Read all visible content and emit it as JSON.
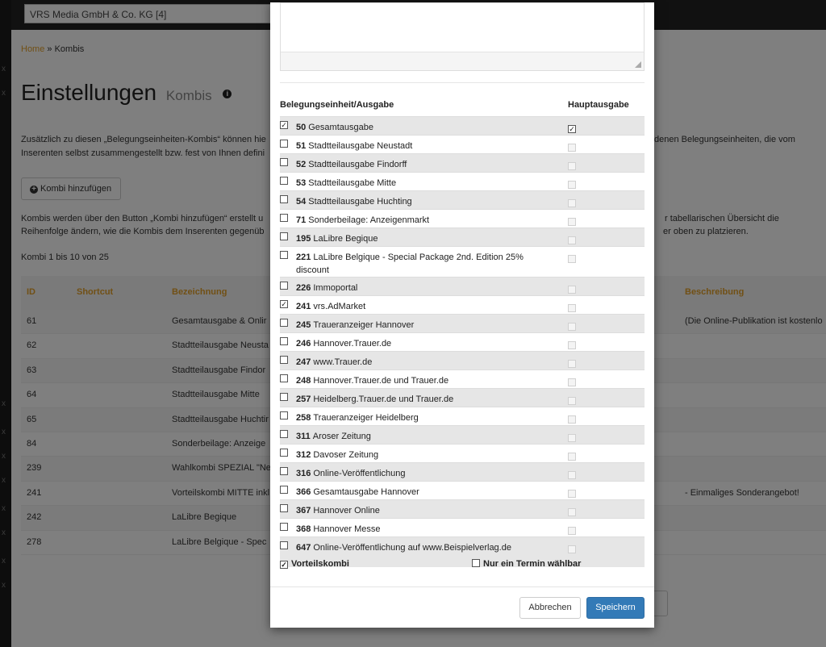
{
  "app": {
    "selected_account": "VRS Media GmbH & Co. KG [4]"
  },
  "breadcrumb": {
    "home": "Home",
    "separator": "»",
    "current": "Kombis"
  },
  "page": {
    "title": "Einstellungen",
    "subtitle": "Kombis",
    "intro_line1": "Zusätzlich zu diesen „Belegungseinheiten-Kombis“ können hie",
    "intro_line1_right": "denen Belegungseinheiten, die vom",
    "intro_line2": "Inserenten selbst zusammengestellt bzw. fest von Ihnen defini",
    "add_button": "Kombi hinzufügen",
    "desc_line1": "Kombis werden über den Button „Kombi hinzufügen“ erstellt u",
    "desc_line1_right": "r tabellarischen Übersicht die",
    "desc_line2": "Reihenfolge ändern, wie die Kombis dem Inserenten gegenüb",
    "desc_line2_right": "er oben zu platzieren.",
    "count": "Kombi 1 bis 10 von 25"
  },
  "table": {
    "headers": {
      "id": "ID",
      "shortcut": "Shortcut",
      "name": "Bezeichnung",
      "description": "Beschreibung"
    },
    "rows": [
      {
        "id": "61",
        "name": "Gesamtausgabe & Onlir",
        "description": "(Die Online-Publikation ist kostenlo"
      },
      {
        "id": "62",
        "name": "Stadtteilausgabe Neusta",
        "description": ""
      },
      {
        "id": "63",
        "name": "Stadtteilausgabe Findor",
        "description": ""
      },
      {
        "id": "64",
        "name": "Stadtteilausgabe Mitte",
        "description": ""
      },
      {
        "id": "65",
        "name": "Stadtteilausgabe Huchtir",
        "description": ""
      },
      {
        "id": "84",
        "name": "Sonderbeilage: Anzeige",
        "description": ""
      },
      {
        "id": "239",
        "name": "Wahlkombi SPEZIAL \"Ne",
        "description": ""
      },
      {
        "id": "241",
        "name": "Vorteilskombi MITTE inkl",
        "description": "- Einmaliges Sonderangebot!"
      },
      {
        "id": "242",
        "name": "LaLibre Begique",
        "description": ""
      },
      {
        "id": "278",
        "name": "LaLibre Belgique - Spec",
        "description": ""
      }
    ]
  },
  "modal": {
    "col_unit": "Belegungseinheit/Ausgabe",
    "col_main": "Hauptausgabe",
    "units": [
      {
        "num": "50",
        "label": "Gesamtausgabe",
        "checked": true,
        "main": true
      },
      {
        "num": "51",
        "label": "Stadtteilausgabe Neustadt",
        "checked": false,
        "main": false
      },
      {
        "num": "52",
        "label": "Stadtteilausgabe Findorff",
        "checked": false,
        "main": false
      },
      {
        "num": "53",
        "label": "Stadtteilausgabe Mitte",
        "checked": false,
        "main": false
      },
      {
        "num": "54",
        "label": "Stadtteilausgabe Huchting",
        "checked": false,
        "main": false
      },
      {
        "num": "71",
        "label": "Sonderbeilage: Anzeigenmarkt",
        "checked": false,
        "main": false
      },
      {
        "num": "195",
        "label": "LaLibre Begique",
        "checked": false,
        "main": false
      },
      {
        "num": "221",
        "label": "LaLibre Belgique - Special Package 2nd. Edition 25% discount",
        "checked": false,
        "main": false
      },
      {
        "num": "226",
        "label": "Immoportal",
        "checked": false,
        "main": false
      },
      {
        "num": "241",
        "label": "vrs.AdMarket",
        "checked": true,
        "main": false
      },
      {
        "num": "245",
        "label": "Traueranzeiger Hannover",
        "checked": false,
        "main": false
      },
      {
        "num": "246",
        "label": "Hannover.Trauer.de",
        "checked": false,
        "main": false
      },
      {
        "num": "247",
        "label": "www.Trauer.de",
        "checked": false,
        "main": false
      },
      {
        "num": "248",
        "label": "Hannover.Trauer.de und Trauer.de",
        "checked": false,
        "main": false
      },
      {
        "num": "257",
        "label": "Heidelberg.Trauer.de und Trauer.de",
        "checked": false,
        "main": false
      },
      {
        "num": "258",
        "label": "Traueranzeiger Heidelberg",
        "checked": false,
        "main": false
      },
      {
        "num": "311",
        "label": "Aroser Zeitung",
        "checked": false,
        "main": false
      },
      {
        "num": "312",
        "label": "Davoser Zeitung",
        "checked": false,
        "main": false
      },
      {
        "num": "316",
        "label": "Online-Veröffentlichung",
        "checked": false,
        "main": false
      },
      {
        "num": "366",
        "label": "Gesamtausgabe Hannover",
        "checked": false,
        "main": false
      },
      {
        "num": "367",
        "label": "Hannover Online",
        "checked": false,
        "main": false
      },
      {
        "num": "368",
        "label": "Hannover Messe",
        "checked": false,
        "main": false
      },
      {
        "num": "647",
        "label": "Online-Veröffentlichung auf www.Beispielverlag.de",
        "checked": false,
        "main": false
      }
    ],
    "vorteilskombi": {
      "label": "Vorteilskombi",
      "checked": true
    },
    "single_date": {
      "label": "Nur ein Termin wählbar",
      "checked": false
    },
    "cancel": "Abbrechen",
    "save": "Speichern"
  },
  "colors": {
    "accent": "#e2a02a",
    "primary": "#337ab7"
  },
  "icons": {
    "info": "info-icon",
    "add": "plus-circle-icon",
    "check": "check-icon",
    "resize": "resize-grip-icon"
  }
}
